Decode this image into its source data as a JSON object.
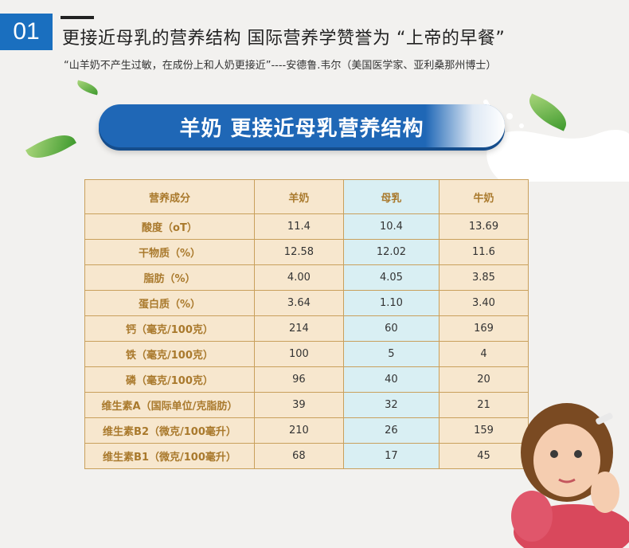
{
  "section_number": "01",
  "headline": "更接近母乳的营养结构  国际营养学赞誉为 “上帝的早餐”",
  "quote": "“山羊奶不产生过敏，在成份上和人奶更接近”----安德鲁.韦尔（美国医学家、亚利桑那州博士）",
  "banner_title": "羊奶  更接近母乳营养结构",
  "colors": {
    "accent_blue": "#1a6fbf",
    "table_border": "#c9a05c",
    "table_text": "#a9792c",
    "highlight_column": "#d9eff3"
  },
  "table": {
    "headers": [
      "营养成分",
      "羊奶",
      "母乳",
      "牛奶"
    ],
    "rows": [
      {
        "name": "酸度（oT）",
        "goat": "11.4",
        "human": "10.4",
        "cow": "13.69"
      },
      {
        "name": "干物质（%）",
        "goat": "12.58",
        "human": "12.02",
        "cow": "11.6"
      },
      {
        "name": "脂肪（%）",
        "goat": "4.00",
        "human": "4.05",
        "cow": "3.85"
      },
      {
        "name": "蛋白质（%）",
        "goat": "3.64",
        "human": "1.10",
        "cow": "3.40"
      },
      {
        "name": "钙（毫克/100克）",
        "goat": "214",
        "human": "60",
        "cow": "169"
      },
      {
        "name": "铁（毫克/100克）",
        "goat": "100",
        "human": "5",
        "cow": "4"
      },
      {
        "name": "磷（毫克/100克）",
        "goat": "96",
        "human": "40",
        "cow": "20"
      },
      {
        "name": "维生素A（国际单位/克脂肪）",
        "goat": "39",
        "human": "32",
        "cow": "21"
      },
      {
        "name": "维生素B2（微克/100毫升）",
        "goat": "210",
        "human": "26",
        "cow": "159"
      },
      {
        "name": "维生素B1（微克/100毫升）",
        "goat": "68",
        "human": "17",
        "cow": "45"
      }
    ]
  }
}
